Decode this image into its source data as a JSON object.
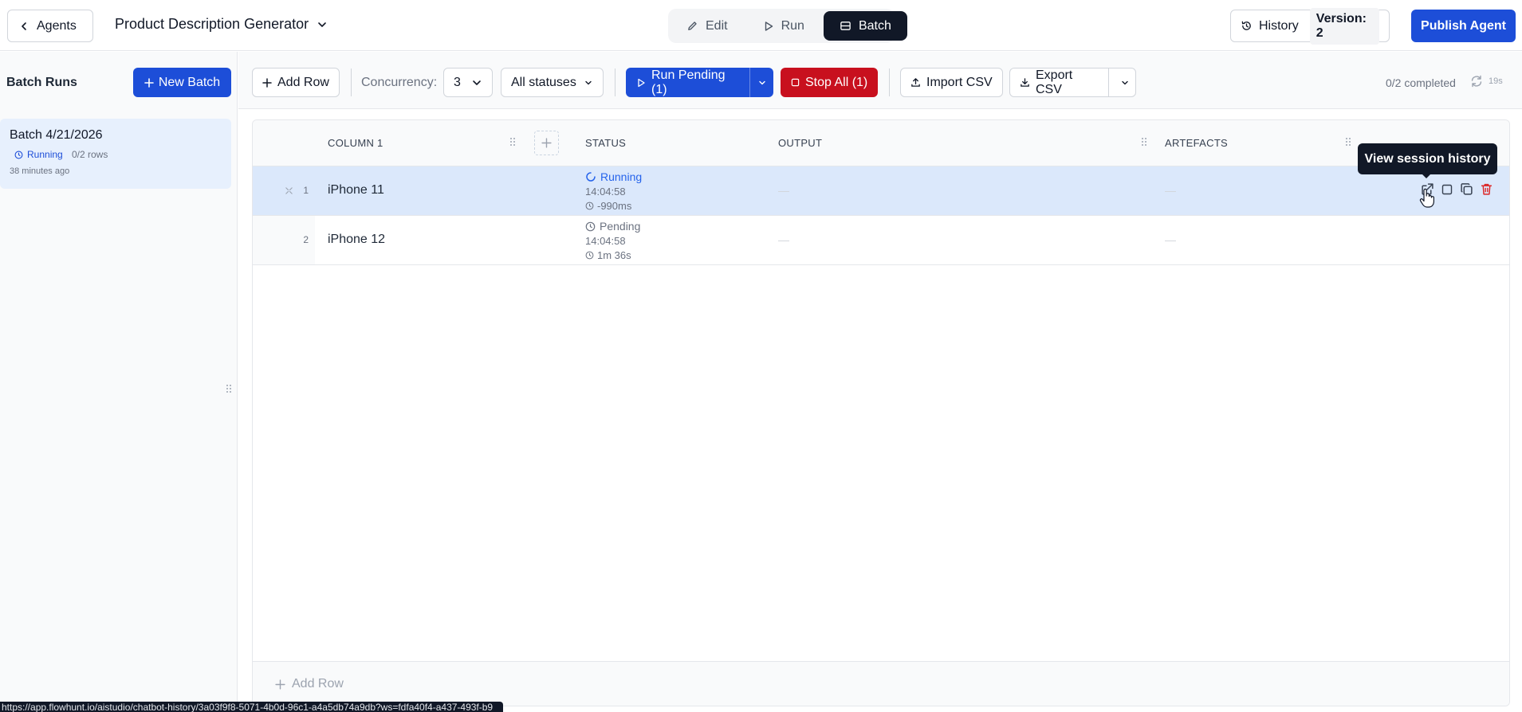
{
  "topbar": {
    "back_label": "Agents",
    "agent_title": "Product Description Generator",
    "modes": [
      {
        "label": "Edit",
        "icon": "pencil-icon"
      },
      {
        "label": "Run",
        "icon": "play-icon"
      },
      {
        "label": "Batch",
        "icon": "batch-icon",
        "active": true
      }
    ],
    "history_label": "History",
    "version_label": "Version: 2",
    "publish_label": "Publish Agent"
  },
  "sidebar": {
    "title": "Batch Runs",
    "new_batch_label": "New Batch",
    "batches": [
      {
        "name": "Batch 4/21/2026",
        "status": "Running",
        "rows": "0/2 rows",
        "time": "38 minutes ago"
      }
    ]
  },
  "toolbar": {
    "add_row_label": "Add Row",
    "concurrency_label": "Concurrency:",
    "concurrency_value": "3",
    "status_filter": "All statuses",
    "run_pending_label": "Run Pending (1)",
    "stop_all_label": "Stop All (1)",
    "import_label": "Import CSV",
    "export_label": "Export CSV",
    "completed_label": "0/2 completed",
    "refresh_label": "19s"
  },
  "table": {
    "columns": [
      "COLUMN 1",
      "STATUS",
      "OUTPUT",
      "ARTEFACTS"
    ],
    "rows": [
      {
        "num": "1",
        "value": "iPhone 11",
        "status": "Running",
        "time": "14:04:58",
        "duration": "-990ms",
        "output": "—",
        "artefacts": "—"
      },
      {
        "num": "2",
        "value": "iPhone 12",
        "status": "Pending",
        "time": "14:04:58",
        "duration": "1m 36s",
        "output": "—",
        "artefacts": "—"
      }
    ],
    "footer_add_label": "Add Row"
  },
  "tooltip": "View session history",
  "status_url": "https://app.flowhunt.io/aistudio/chatbot-history/3a03f9f8-5071-4b0d-96c1-a4a5db74a9db?ws=fdfa40f4-a437-493f-b9",
  "colors": {
    "primary": "#1d4ed8",
    "danger": "#c8101e",
    "running": "#2563eb",
    "selected_row": "#dbe8fb"
  }
}
